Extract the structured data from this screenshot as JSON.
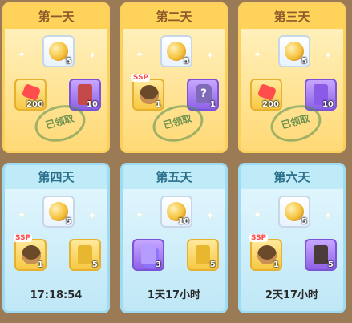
{
  "days": [
    {
      "title": "第一天",
      "state": "claimed",
      "stamp": "已领取",
      "top_qty": "5",
      "items": [
        {
          "icon": "red-gem-icon",
          "qty": "200"
        },
        {
          "icon": "book-icon",
          "qty": "10"
        }
      ]
    },
    {
      "title": "第二天",
      "state": "claimed",
      "stamp": "已领取",
      "top_qty": "5",
      "items": [
        {
          "icon": "raccoon-icon",
          "qty": "1",
          "badge": "SSP"
        },
        {
          "icon": "mystery-bag-icon",
          "qty": "1"
        }
      ]
    },
    {
      "title": "第三天",
      "state": "claimed",
      "stamp": "已领取",
      "top_qty": "5",
      "items": [
        {
          "icon": "red-gem-icon",
          "qty": "200"
        },
        {
          "icon": "book-icon",
          "qty": "10"
        }
      ]
    },
    {
      "title": "第四天",
      "state": "pending",
      "timer": "17:18:54",
      "top_qty": "5",
      "items": [
        {
          "icon": "raccoon-icon",
          "qty": "1",
          "badge": "SSP"
        },
        {
          "icon": "gold-book-icon",
          "qty": "5"
        }
      ]
    },
    {
      "title": "第五天",
      "state": "pending",
      "timer": "1天17小时",
      "top_qty": "10",
      "items": [
        {
          "icon": "cards-icon",
          "qty": "3"
        },
        {
          "icon": "gold-book-icon",
          "qty": "5"
        }
      ]
    },
    {
      "title": "第六天",
      "state": "pending",
      "timer": "2天17小时",
      "top_qty": "5",
      "items": [
        {
          "icon": "raccoon-icon",
          "qty": "1",
          "badge": "SSP"
        },
        {
          "icon": "black-book-icon",
          "qty": "5"
        }
      ]
    }
  ]
}
